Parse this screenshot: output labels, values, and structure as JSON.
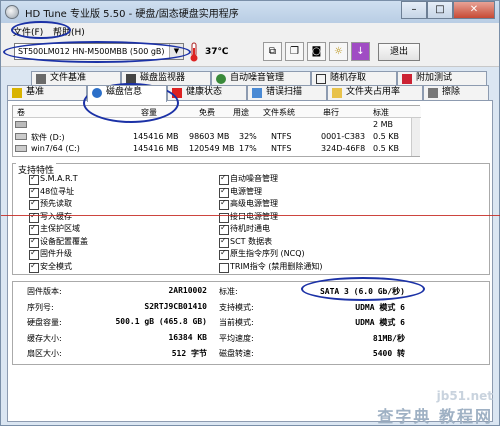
{
  "window": {
    "title": "HD Tune 专业版 5.50 - 硬盘/固态硬盘实用程序",
    "close_glyph": "✕"
  },
  "menubar": {
    "file": "文件(F)",
    "help": "帮助(H)"
  },
  "toolbar": {
    "drive": "ST500LM012 HN-M500MBB (500 gB)",
    "temperature": "37℃",
    "exit": "退出"
  },
  "tabs_top": [
    "文件基准",
    "磁盘监视器",
    "自动噪音管理",
    "随机存取",
    "附加测试"
  ],
  "tabs_bottom": [
    "基准",
    "磁盘信息",
    "健康状态",
    "错误扫描",
    "文件夹占用率",
    "擦除"
  ],
  "partitions": {
    "headers": [
      "卷",
      "容量",
      "免费",
      "用途",
      "文件系统",
      "串行",
      "标准"
    ],
    "rows": [
      {
        "volume": "",
        "capacity": "",
        "free": "",
        "usage": "",
        "fs": "",
        "serial": "",
        "standard": "2 MB"
      },
      {
        "volume": "软件 (D:)",
        "capacity": "145416 MB",
        "free": "98603 MB",
        "usage": "32%",
        "fs": "NTFS",
        "serial": "0001-C383",
        "standard": "0.5 KB"
      },
      {
        "volume": "win7/64 (C:)",
        "capacity": "145416 MB",
        "free": "120549 MB",
        "usage": "17%",
        "fs": "NTFS",
        "serial": "324D-46F8",
        "standard": "0.5 KB"
      }
    ]
  },
  "features": {
    "title": "支持特性",
    "left": [
      {
        "label": "S.M.A.R.T",
        "checked": true
      },
      {
        "label": "48位寻址",
        "checked": true
      },
      {
        "label": "预先读取",
        "checked": true
      },
      {
        "label": "写入缓存",
        "checked": true
      },
      {
        "label": "主保护区域",
        "checked": true
      },
      {
        "label": "设备配置覆盖",
        "checked": true
      },
      {
        "label": "固件升级",
        "checked": true
      },
      {
        "label": "安全模式",
        "checked": true
      }
    ],
    "right": [
      {
        "label": "自动噪音管理",
        "checked": true
      },
      {
        "label": "电源管理",
        "checked": true
      },
      {
        "label": "高级电源管理",
        "checked": true
      },
      {
        "label": "接口电源管理",
        "checked": false
      },
      {
        "label": "待机时通电",
        "checked": true
      },
      {
        "label": "SCT 数据表",
        "checked": true
      },
      {
        "label": "原生指令序列 (NCQ)",
        "checked": true
      },
      {
        "label": "TRIM指令 (禁用删除通知)",
        "checked": false
      }
    ]
  },
  "info": {
    "left": [
      {
        "label": "固件版本:",
        "value": "2AR10002"
      },
      {
        "label": "序列号:",
        "value": "S2RTJ9CB01410"
      },
      {
        "label": "硬盘容量:",
        "value": "500.1 gB (465.8 GB)"
      },
      {
        "label": "缓存大小:",
        "value": "16384 KB"
      },
      {
        "label": "扇区大小:",
        "value": "512 字节"
      }
    ],
    "right": [
      {
        "label": "标准:",
        "value": "SATA 3 (6.0 Gb/秒)"
      },
      {
        "label": "支持模式:",
        "value": "UDMA 模式 6"
      },
      {
        "label": "当前模式:",
        "value": "UDMA 模式 6"
      },
      {
        "label": "平均速度:",
        "value": "81MB/秒"
      },
      {
        "label": "磁盘转速:",
        "value": "5400 转"
      }
    ]
  },
  "watermark": {
    "site": "jb51.net",
    "brand": "查字典 教程网"
  }
}
